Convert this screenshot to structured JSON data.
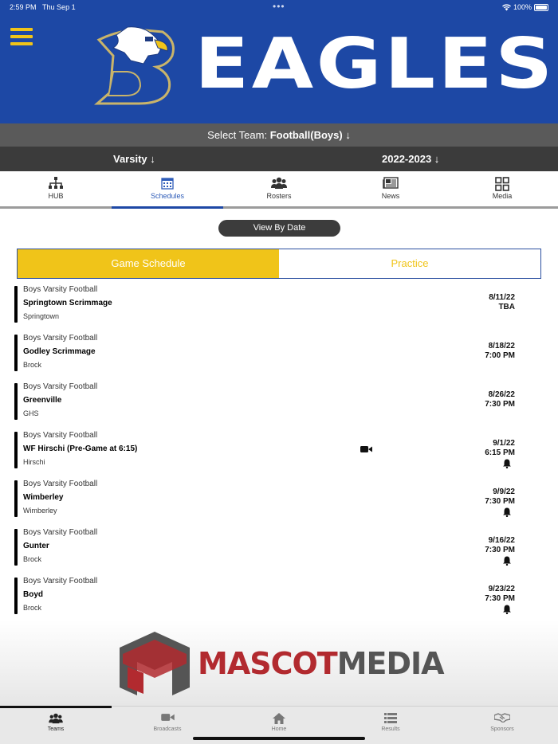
{
  "status": {
    "time": "2:59 PM",
    "date": "Thu Sep 1",
    "battery": "100%",
    "dots": "•••"
  },
  "header": {
    "title": "EAGLES",
    "colors": {
      "brand_blue": "#1d48a5",
      "accent_gold": "#f0c419"
    }
  },
  "team_select": {
    "label": "Select Team:",
    "value": "Football(Boys)",
    "arrow": "↓"
  },
  "level_select": {
    "value": "Varsity",
    "arrow": "↓"
  },
  "season_select": {
    "value": "2022-2023",
    "arrow": "↓"
  },
  "tabs": [
    {
      "label": "HUB",
      "icon": "org-chart-icon"
    },
    {
      "label": "Schedules",
      "icon": "calendar-icon",
      "active": true
    },
    {
      "label": "Rosters",
      "icon": "people-icon"
    },
    {
      "label": "News",
      "icon": "newspaper-icon"
    },
    {
      "label": "Media",
      "icon": "grid-icon"
    }
  ],
  "view_by_date": "View By Date",
  "segment": {
    "game": "Game Schedule",
    "practice": "Practice"
  },
  "games": [
    {
      "league": "Boys Varsity Football",
      "opponent": "Springtown Scrimmage",
      "location": "Springtown",
      "date": "8/11/22",
      "time": "TBA",
      "bell": false
    },
    {
      "league": "Boys Varsity Football",
      "opponent": "Godley Scrimmage",
      "location": "Brock",
      "date": "8/18/22",
      "time": "7:00 PM",
      "bell": false
    },
    {
      "league": "Boys Varsity Football",
      "opponent": "Greenville",
      "location": "GHS",
      "date": "8/26/22",
      "time": "7:30 PM",
      "bell": false
    },
    {
      "league": "Boys Varsity Football",
      "opponent": "WF Hirschi (Pre-Game at 6:15)",
      "location": "Hirschi",
      "date": "9/1/22",
      "time": "6:15 PM",
      "bell": true,
      "video": true
    },
    {
      "league": "Boys Varsity Football",
      "opponent": "Wimberley",
      "location": "Wimberley",
      "date": "9/9/22",
      "time": "7:30 PM",
      "bell": true
    },
    {
      "league": "Boys Varsity Football",
      "opponent": "Gunter",
      "location": "Brock",
      "date": "9/16/22",
      "time": "7:30 PM",
      "bell": true
    },
    {
      "league": "Boys Varsity Football",
      "opponent": "Boyd",
      "location": "Brock",
      "date": "9/23/22",
      "time": "7:30 PM",
      "bell": true
    }
  ],
  "sponsor": {
    "part1": "MASCOT",
    "part2": "MEDIA"
  },
  "bottom_nav": [
    {
      "label": "Teams",
      "icon": "team-icon",
      "active": true
    },
    {
      "label": "Broadcasts",
      "icon": "video-icon"
    },
    {
      "label": "Home",
      "icon": "home-icon"
    },
    {
      "label": "Results",
      "icon": "list-icon"
    },
    {
      "label": "Sponsors",
      "icon": "handshake-icon"
    }
  ]
}
